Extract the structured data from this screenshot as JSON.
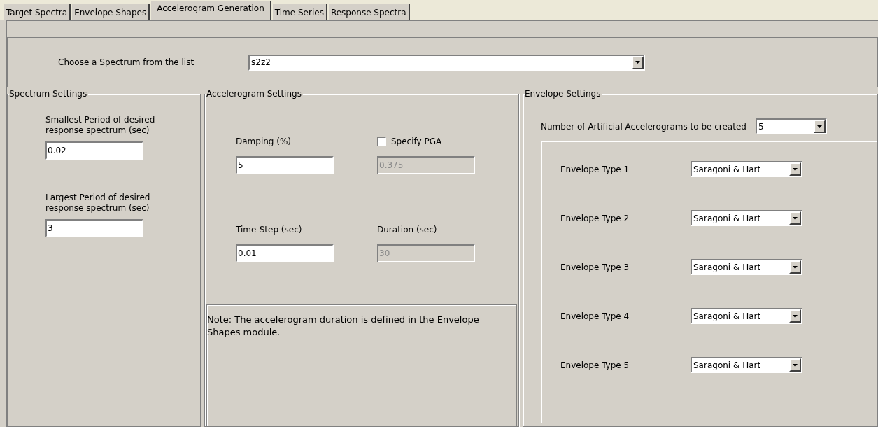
{
  "tabs": [
    {
      "label": "Target Spectra",
      "selected": false
    },
    {
      "label": "Envelope Shapes",
      "selected": false
    },
    {
      "label": "Accelerogram Generation",
      "selected": true
    },
    {
      "label": "Time Series",
      "selected": false
    },
    {
      "label": "Response Spectra",
      "selected": false
    }
  ],
  "spectrum_chooser": {
    "label": "Choose a Spectrum from the  list",
    "value": "s2z2"
  },
  "spectrum_settings": {
    "title": "Spectrum Settings",
    "fields": [
      {
        "label": "Smallest Period of desired response spectrum (sec)",
        "value": "0.02"
      },
      {
        "label": "Largest Period of desired response spectrum (sec)",
        "value": "3"
      }
    ]
  },
  "accelerogram_settings": {
    "title": "Accelerogram Settings",
    "items": [
      {
        "kind": "field",
        "label": "Damping (%)",
        "value": "5",
        "disabled": false
      },
      {
        "kind": "checkbox_field",
        "label": "Specify PGA",
        "checked": false,
        "value": "0.375",
        "disabled": true
      },
      {
        "kind": "field",
        "label": "Time-Step (sec)",
        "value": "0.01",
        "disabled": false
      },
      {
        "kind": "field",
        "label": "Duration (sec)",
        "value": "30",
        "disabled": true
      }
    ],
    "note": "Note: The accelerogram duration is defined in the Envelope Shapes module."
  },
  "envelope_settings": {
    "title": "Envelope Settings",
    "count": {
      "label": "Number of Artificial Accelerograms to be created",
      "value": "5"
    },
    "envelopes": [
      {
        "label": "Envelope Type 1",
        "value": "Saragoni & Hart"
      },
      {
        "label": "Envelope Type 2",
        "value": "Saragoni & Hart"
      },
      {
        "label": "Envelope Type 3",
        "value": "Saragoni & Hart"
      },
      {
        "label": "Envelope Type 4",
        "value": "Saragoni & Hart"
      },
      {
        "label": "Envelope Type 5",
        "value": "Saragoni & Hart"
      }
    ]
  }
}
